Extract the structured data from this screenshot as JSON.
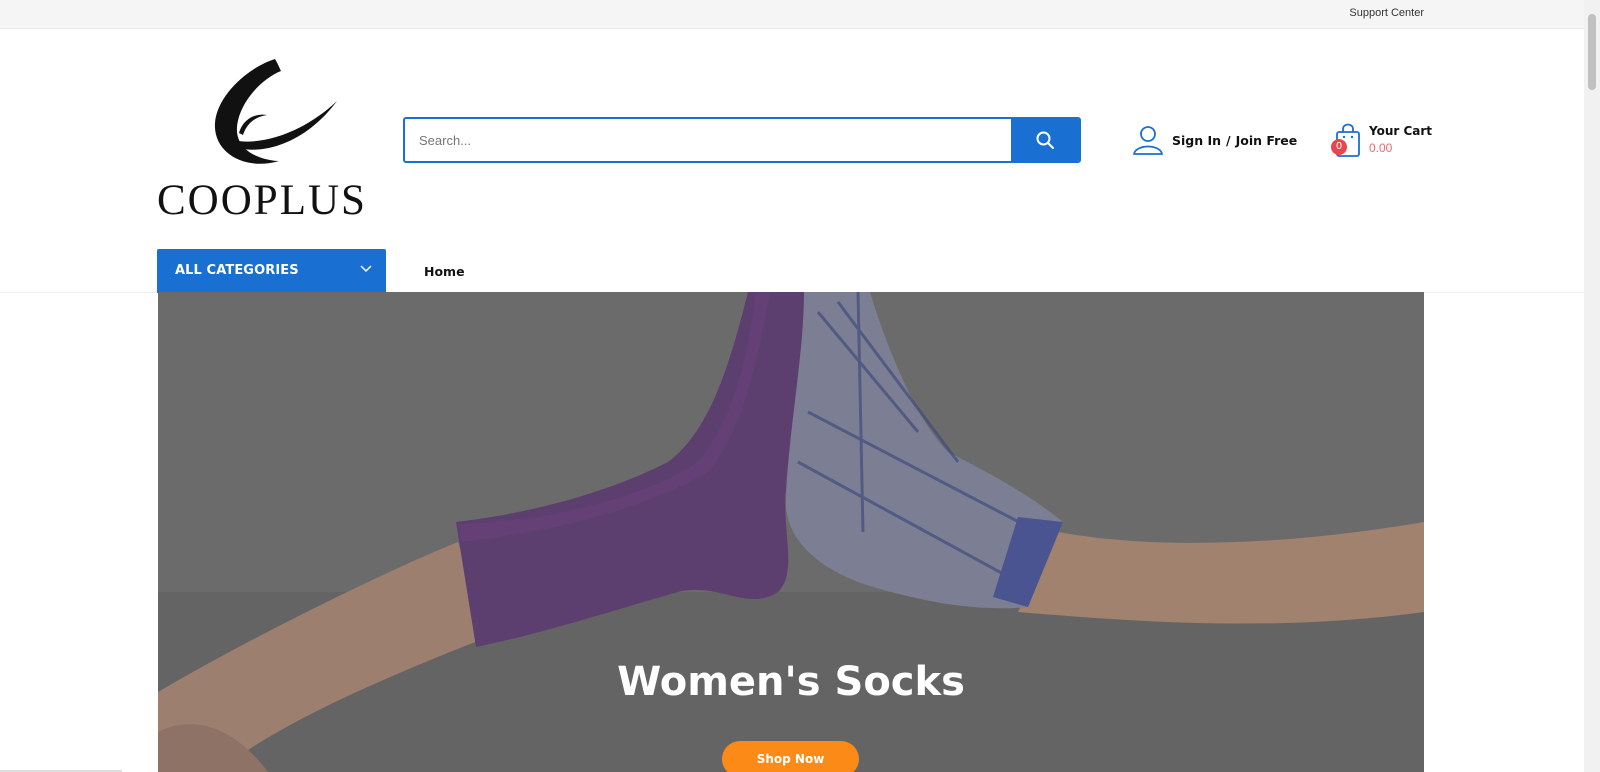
{
  "topbar": {
    "support_label": "Support Center"
  },
  "header": {
    "logo_text": "COOPLUS",
    "search": {
      "placeholder": "Search..."
    },
    "account": {
      "sign_in": "Sign In",
      "separator": "/",
      "join": "Join Free"
    },
    "cart": {
      "title": "Your Cart",
      "count": "0",
      "amount": "0.00"
    }
  },
  "nav": {
    "categories_label": "ALL CATEGORIES",
    "items": [
      {
        "label": "Home"
      }
    ]
  },
  "hero": {
    "headline": "Women's Socks",
    "cta_label": "Shop Now"
  },
  "colors": {
    "primary": "#1a6fd3",
    "cta": "#fb8a16",
    "badge": "#e8454e",
    "price": "#ee6b73"
  },
  "icons": [
    "search-icon",
    "user-icon",
    "cart-bag-icon",
    "chevron-down-icon"
  ]
}
